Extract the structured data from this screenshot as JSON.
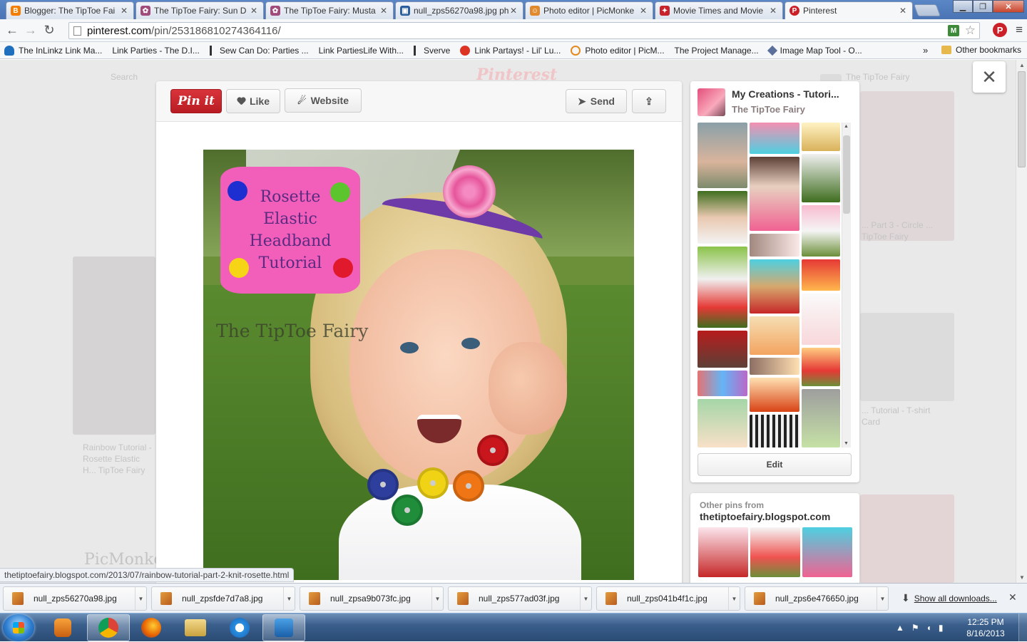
{
  "browser": {
    "tabs": [
      {
        "title": "Blogger: The TipToe Fai",
        "icon": "blogger-icon",
        "color": "#f57d00"
      },
      {
        "title": "The TipToe Fairy: Sun D",
        "icon": "fairy-icon",
        "color": "#a14a7c"
      },
      {
        "title": "The TipToe Fairy: Musta",
        "icon": "fairy-icon",
        "color": "#a14a7c"
      },
      {
        "title": "null_zps56270a98.jpg ph",
        "icon": "photobucket-icon",
        "color": "#2b5e9d"
      },
      {
        "title": "Photo editor | PicMonke",
        "icon": "picmonkey-icon",
        "color": "#e08a2d"
      },
      {
        "title": "Movie Times and Movie",
        "icon": "movie-icon",
        "color": "#c8222a"
      },
      {
        "title": "Pinterest",
        "icon": "pinterest-icon",
        "color": "#cb2027"
      }
    ],
    "active_tab": 6,
    "url_host": "pinterest.com",
    "url_path": "/pin/253186810274364116/",
    "ext_badge": "M",
    "bookmarks": [
      {
        "label": "The InLinkz Link Ma...",
        "icon": "cloud"
      },
      {
        "label": "Link Parties - The D.I...",
        "icon": "page"
      },
      {
        "label": "Sew Can Do: Parties ...",
        "icon": "sverve"
      },
      {
        "label": "Link PartiesLife With...",
        "icon": "page"
      },
      {
        "label": "Sverve",
        "icon": "sverve"
      },
      {
        "label": "Link Partays! - Lil' Lu...",
        "icon": "red"
      },
      {
        "label": "Photo editor | PicM...",
        "icon": "orange"
      },
      {
        "label": "The Project Manage...",
        "icon": "page"
      },
      {
        "label": "Image Map Tool - O...",
        "icon": "tool"
      }
    ],
    "bookmarks_more": "»",
    "other_bookmarks": "Other bookmarks",
    "status_url": "thetiptoefairy.blogspot.com/2013/07/rainbow-tutorial-part-2-knit-rosette.html"
  },
  "pin": {
    "pin_it": "Pin it",
    "like": "Like",
    "website": "Website",
    "send": "Send",
    "image_sign_lines": [
      "Rosette",
      "Elastic Headband",
      "Tutorial"
    ],
    "image_watermark": "The TipToe Fairy"
  },
  "board": {
    "title": "My Creations - Tutori...",
    "owner": "The TipToe Fairy",
    "edit": "Edit"
  },
  "others": {
    "label": "Other pins from",
    "site": "thetiptoefairy.blogspot.com"
  },
  "background": {
    "logo": "Pinterest",
    "search_placeholder": "Search",
    "texts": [
      "Rainbow Tutorial - Rosette Elastic H... TipToe Fairy",
      "... Part 3 - Circle ... TipToe Fairy",
      "... Tutorial - T-shirt Card",
      "PicMonke..."
    ]
  },
  "downloads": {
    "files": [
      "null_zps56270a98.jpg",
      "null_zpsfde7d7a8.jpg",
      "null_zpsa9b073fc.jpg",
      "null_zps577ad03f.jpg",
      "null_zps041b4f1c.jpg",
      "null_zps6e476650.jpg"
    ],
    "show_all": "Show all downloads..."
  },
  "taskbar": {
    "time": "12:25 PM",
    "date": "8/16/2013"
  }
}
